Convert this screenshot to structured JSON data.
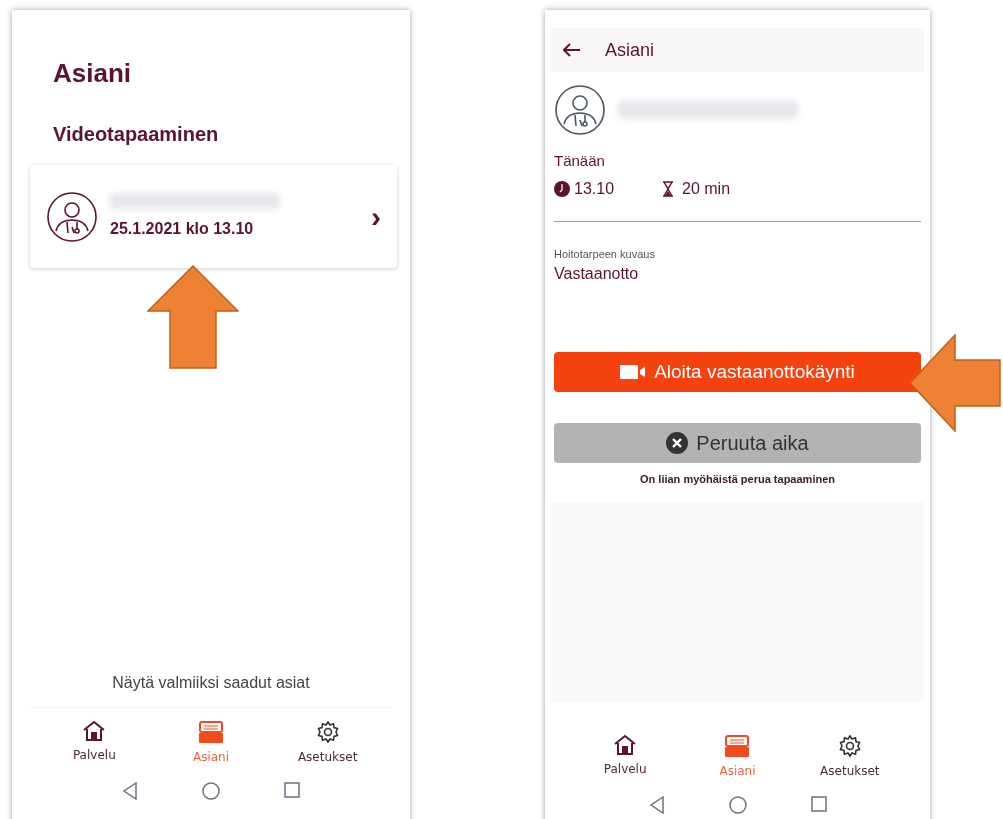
{
  "list_screen": {
    "title": "Asiani",
    "section_heading": "Videotapaaminen",
    "appointment": {
      "datetime": "25.1.2021 klo 13.10",
      "chevron": "›"
    },
    "show_completed_link": "Näytä valmiiksi saadut asiat",
    "nav": [
      {
        "kind": "home",
        "label": "Palvelu",
        "selected": false
      },
      {
        "kind": "inbox",
        "label": "Asiani",
        "selected": true
      },
      {
        "kind": "settings",
        "label": "Asetukset",
        "selected": false
      }
    ]
  },
  "detail_screen": {
    "header_title": "Asiani",
    "day": "Tänään",
    "time": "13.10",
    "duration": "20 min",
    "description_label": "Hoitotarpeen kuvaus",
    "description": "Vastaanotto",
    "start_button": "Aloita vastaanottokäynti",
    "cancel_button": {
      "label": "Peruuta aika",
      "disabled": true
    },
    "cancel_note": "On liian myöhäistä perua tapaaminen",
    "nav": [
      {
        "kind": "home",
        "label": "Palvelu",
        "selected": false
      },
      {
        "kind": "inbox",
        "label": "Asiani",
        "selected": true
      },
      {
        "kind": "settings",
        "label": "Asetukset",
        "selected": false
      }
    ]
  }
}
